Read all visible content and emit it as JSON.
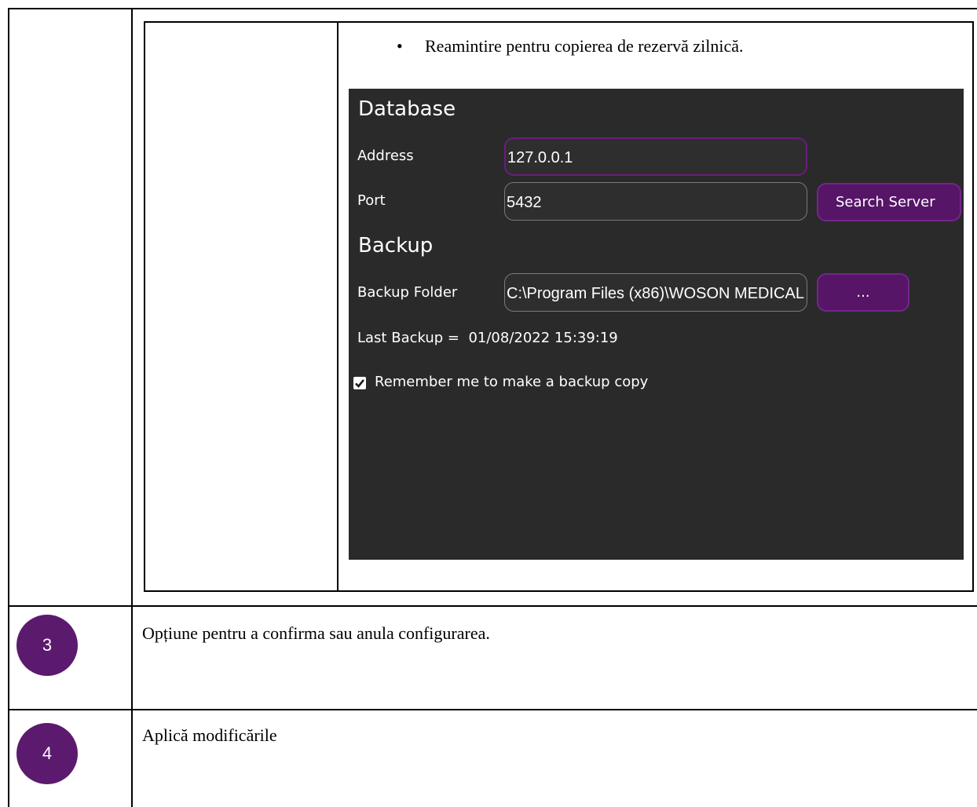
{
  "rows": {
    "row1": {
      "bullet": "•",
      "text": "Reamintire pentru copierea de rezervă zilnică."
    },
    "row3": {
      "number": "3",
      "text": "Opțiune pentru a confirma sau anula configurarea."
    },
    "row4": {
      "number": "4",
      "text": "Aplică modificările"
    }
  },
  "panel": {
    "database": {
      "title": "Database",
      "address_label": "Address",
      "address_value": "127.0.0.1",
      "port_label": "Port",
      "port_value": "5432",
      "search_button": "Search Server"
    },
    "backup": {
      "title": "Backup",
      "folder_label": "Backup Folder",
      "folder_value": "C:\\Program Files (x86)\\WOSON MEDICAL",
      "browse_button": "...",
      "last_backup": "Last Backup =  01/08/2022 15:39:19",
      "remember_label": "Remember me to make a backup copy",
      "remember_checked": true
    }
  },
  "colors": {
    "badge": "#5c1a6e",
    "panel_bg": "#2a2a2a",
    "button": "#561567"
  }
}
